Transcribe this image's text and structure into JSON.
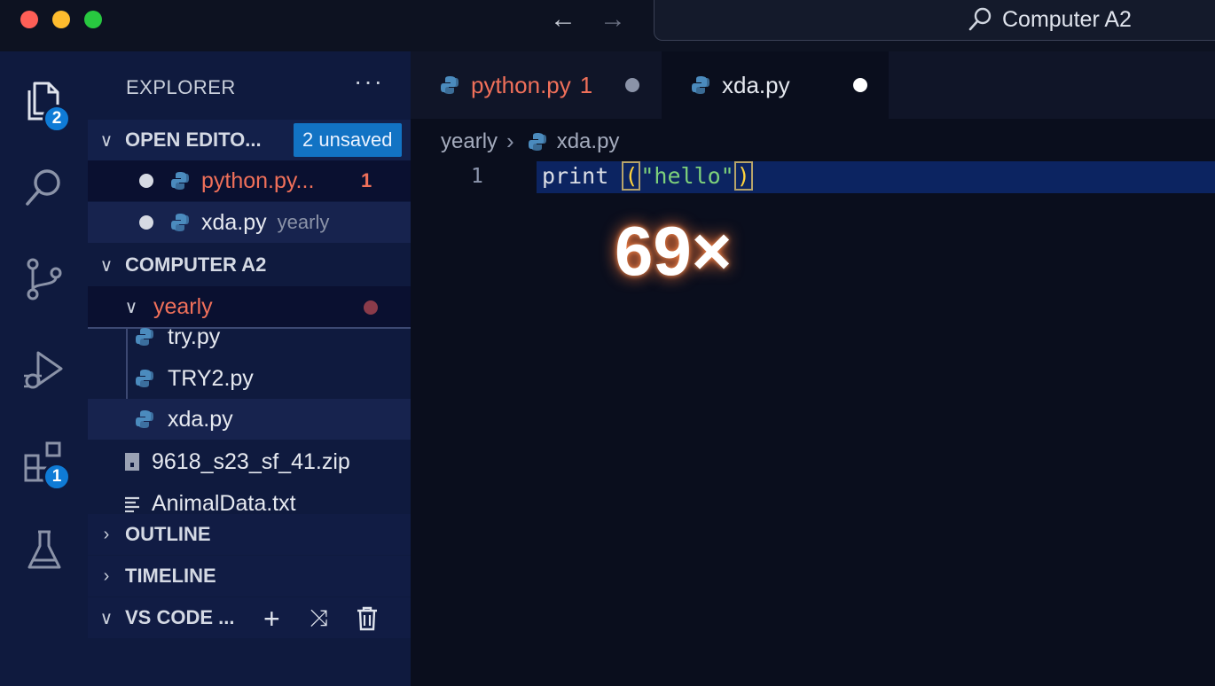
{
  "titlebar": {
    "command_center_title": "Computer A2"
  },
  "activity": {
    "explorer_badge": "2",
    "extensions_badge": "1"
  },
  "sidebar": {
    "header": "EXPLORER",
    "more": "···",
    "open_editors": {
      "label": "OPEN EDITO...",
      "unsaved": "2 unsaved",
      "items": [
        {
          "name": "python.py...",
          "problems": "1"
        },
        {
          "name": "xda.py",
          "folder": "yearly"
        }
      ]
    },
    "workspace": {
      "label": "COMPUTER A2",
      "folder": "yearly",
      "files": [
        "try.py",
        "TRY2.py",
        "xda.py"
      ],
      "root_files": [
        "9618_s23_sf_41.zip",
        "AnimalData.txt"
      ]
    },
    "outline": "OUTLINE",
    "timeline": "TIMELINE",
    "vscode": "VS CODE ..."
  },
  "editor": {
    "tabs": [
      {
        "name": "python.py",
        "problems": "1"
      },
      {
        "name": "xda.py"
      }
    ],
    "breadcrumb": {
      "folder": "yearly",
      "file": "xda.py"
    },
    "line_number": "1",
    "code": {
      "fn": "print ",
      "open": "(",
      "str": "\"hello\"",
      "close": ")"
    },
    "overlay": "69×"
  },
  "colors": {
    "accent": "#1273c4",
    "error": "#f0705a",
    "python_blue": "#4b8bbe"
  }
}
